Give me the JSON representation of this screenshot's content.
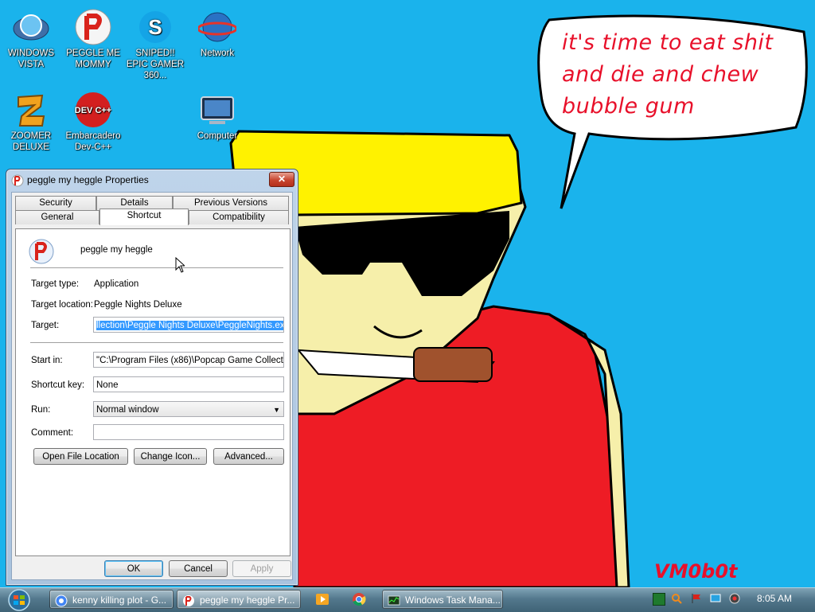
{
  "desktop": {
    "icons": [
      {
        "label": "WINDOWS VISTA",
        "icon": "windows-vista-icon"
      },
      {
        "label": "PEGGLE ME MOMMY",
        "icon": "peggle-icon"
      },
      {
        "label": "SNIPED!! EPIC GAMER 360...",
        "icon": "skype-icon"
      },
      {
        "label": "Network",
        "icon": "network-icon"
      },
      {
        "label": "ZOOMER DELUXE",
        "icon": "zoomer-icon"
      },
      {
        "label": "Embarcadero Dev-C++",
        "icon": "devcpp-icon"
      },
      {
        "label": "Computer",
        "icon": "computer-icon"
      }
    ],
    "wallpaper_text": "it's time to eat shit and die and chew bubble gum",
    "wallpaper_signature": "VM0b0t",
    "devcpp_text": "DEV C++",
    "skype_text": "S"
  },
  "dialog": {
    "title": "peggle my heggle Properties",
    "close_label": "✕",
    "tabs_row1": [
      "Security",
      "Details",
      "Previous Versions"
    ],
    "tabs_row2": [
      "General",
      "Shortcut",
      "Compatibility"
    ],
    "active_tab": "Shortcut",
    "name": "peggle my heggle",
    "target_type_label": "Target type:",
    "target_type": "Application",
    "target_location_label": "Target location:",
    "target_location": "Peggle Nights Deluxe",
    "target_label": "Target:",
    "target_value": "llection\\Peggle Nights Deluxe\\PeggleNights.exe\"",
    "start_in_label": "Start in:",
    "start_in_value": "\"C:\\Program Files (x86)\\Popcap Game Collection\\",
    "shortcut_key_label": "Shortcut key:",
    "shortcut_key_value": "None",
    "run_label": "Run:",
    "run_value": "Normal window",
    "comment_label": "Comment:",
    "comment_value": "",
    "open_file_location": "Open File Location",
    "change_icon": "Change Icon...",
    "advanced": "Advanced...",
    "ok": "OK",
    "cancel": "Cancel",
    "apply": "Apply"
  },
  "taskbar": {
    "tasks": [
      {
        "label": "kenny killing plot - G...",
        "icon": "chrome-icon"
      },
      {
        "label": "peggle my heggle Pr...",
        "icon": "peggle-icon",
        "active": true
      },
      {
        "label": "Windows Task Mana...",
        "icon": "task-manager-icon"
      }
    ],
    "clock": "8:05 AM"
  },
  "colors": {
    "desktop": "#1ab3ec",
    "speech_text": "#e8102a",
    "shirt": "#ee1c25",
    "hair": "#fff200",
    "skin": "#f6efaa"
  }
}
